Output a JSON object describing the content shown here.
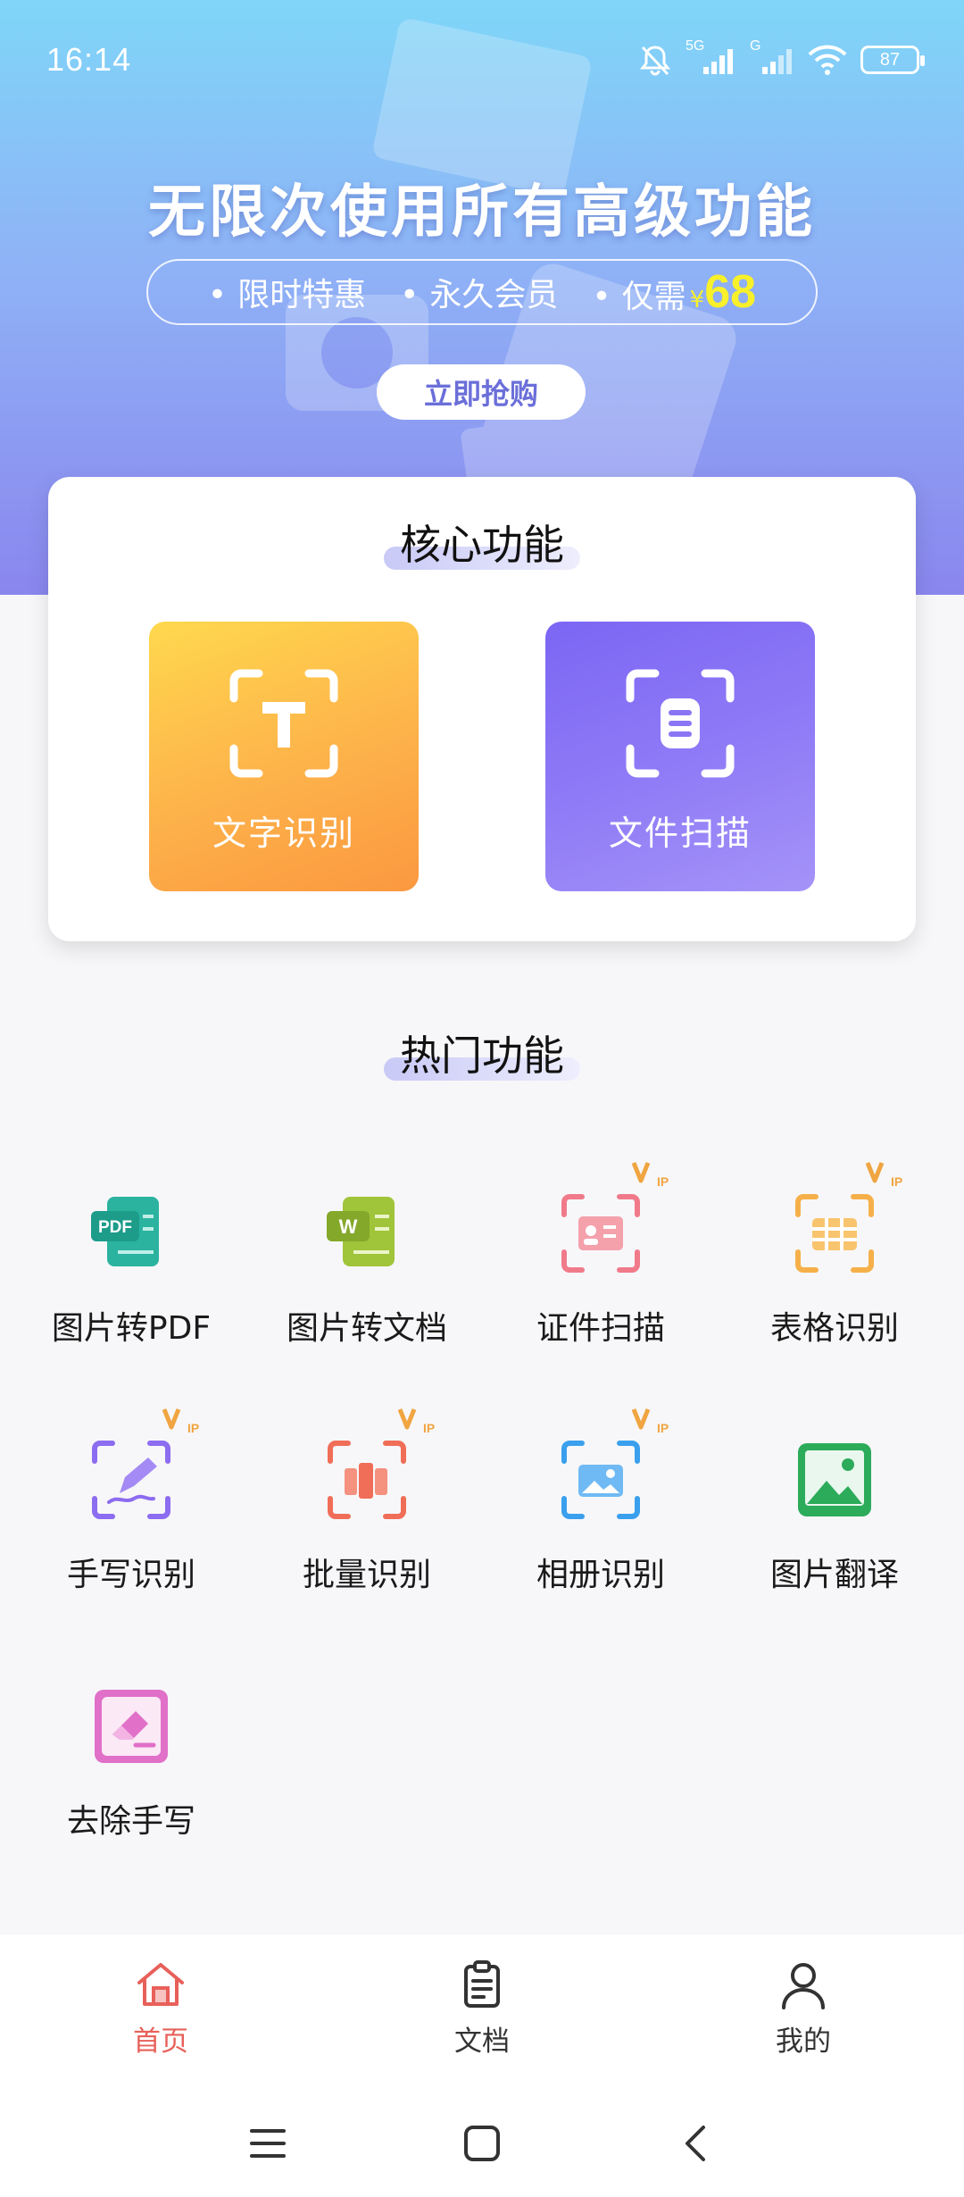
{
  "status_bar": {
    "time": "16:14",
    "network_1": "5G",
    "network_2": "G",
    "battery": "87"
  },
  "banner": {
    "title": "无限次使用所有高级功能",
    "features": [
      "限时特惠",
      "永久会员",
      "仅需"
    ],
    "price_symbol": "¥",
    "price": "68",
    "buy_button": "立即抢购"
  },
  "core": {
    "title": "核心功能",
    "tiles": [
      {
        "label": "文字识别",
        "icon": "text-recognition-icon",
        "color": "#fdb24a"
      },
      {
        "label": "文件扫描",
        "icon": "document-scan-icon",
        "color": "#8a76f5"
      }
    ]
  },
  "hot": {
    "title": "热门功能",
    "items": [
      {
        "label": "图片转PDF",
        "icon": "pdf-icon",
        "vip": false
      },
      {
        "label": "图片转文档",
        "icon": "word-icon",
        "vip": false
      },
      {
        "label": "证件扫描",
        "icon": "id-card-scan-icon",
        "vip": true
      },
      {
        "label": "表格识别",
        "icon": "table-recognition-icon",
        "vip": true
      },
      {
        "label": "手写识别",
        "icon": "handwriting-icon",
        "vip": true
      },
      {
        "label": "批量识别",
        "icon": "batch-recognition-icon",
        "vip": true
      },
      {
        "label": "相册识别",
        "icon": "album-recognition-icon",
        "vip": true
      },
      {
        "label": "图片翻译",
        "icon": "image-translate-icon",
        "vip": false
      },
      {
        "label": "去除手写",
        "icon": "eraser-icon",
        "vip": false
      }
    ]
  },
  "bottom_nav": {
    "items": [
      {
        "label": "首页",
        "icon": "home-icon",
        "active": true
      },
      {
        "label": "文档",
        "icon": "clipboard-icon",
        "active": false
      },
      {
        "label": "我的",
        "icon": "profile-icon",
        "active": false
      }
    ]
  },
  "colors": {
    "accent_active": "#e8605a",
    "vip_badge": "#f0a541",
    "banner_top": "#7fd6f8",
    "banner_bottom": "#8a86ee"
  }
}
